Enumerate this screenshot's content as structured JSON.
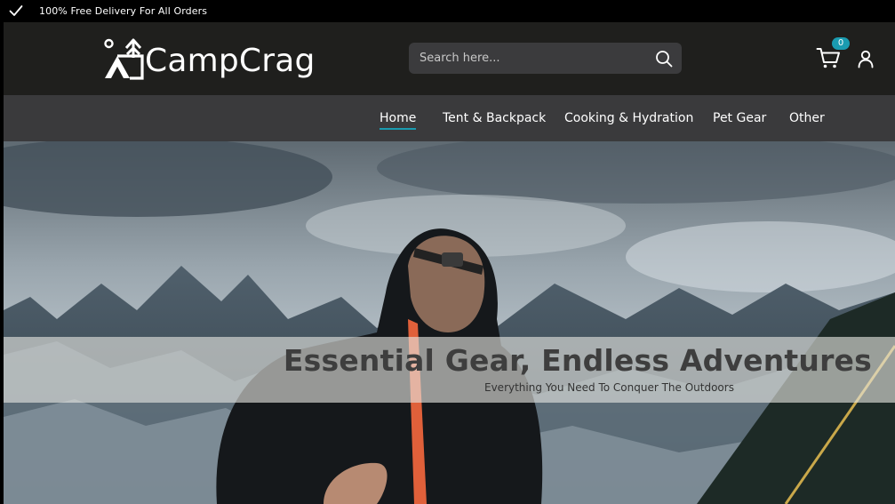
{
  "announcement": {
    "icon": "check-icon",
    "text": "100% Free Delivery For All Orders"
  },
  "header": {
    "brand": {
      "name": "CampCrag",
      "icon": "tent-logo-icon"
    },
    "search": {
      "placeholder": "Search here...",
      "value": "",
      "icon": "search-icon"
    },
    "cart": {
      "icon": "cart-icon",
      "count": "0"
    },
    "account": {
      "icon": "user-icon"
    }
  },
  "nav": {
    "items": [
      {
        "label": "Home",
        "active": true
      },
      {
        "label": "Tent & Backpack",
        "active": false
      },
      {
        "label": "Cooking & Hydration",
        "active": false
      },
      {
        "label": "Pet Gear",
        "active": false
      },
      {
        "label": "Other",
        "active": false
      }
    ]
  },
  "hero": {
    "image": "hiker-with-headlamp-mountains",
    "headline": "Essential Gear, Endless Adventures",
    "subheadline": "Everything You Need To Conquer The Outdoors"
  },
  "colors": {
    "accent": "#1a9bb0",
    "header_bg": "#1f1f1d",
    "nav_bg": "#3a3a3c",
    "search_bg": "#3b3b3d"
  }
}
